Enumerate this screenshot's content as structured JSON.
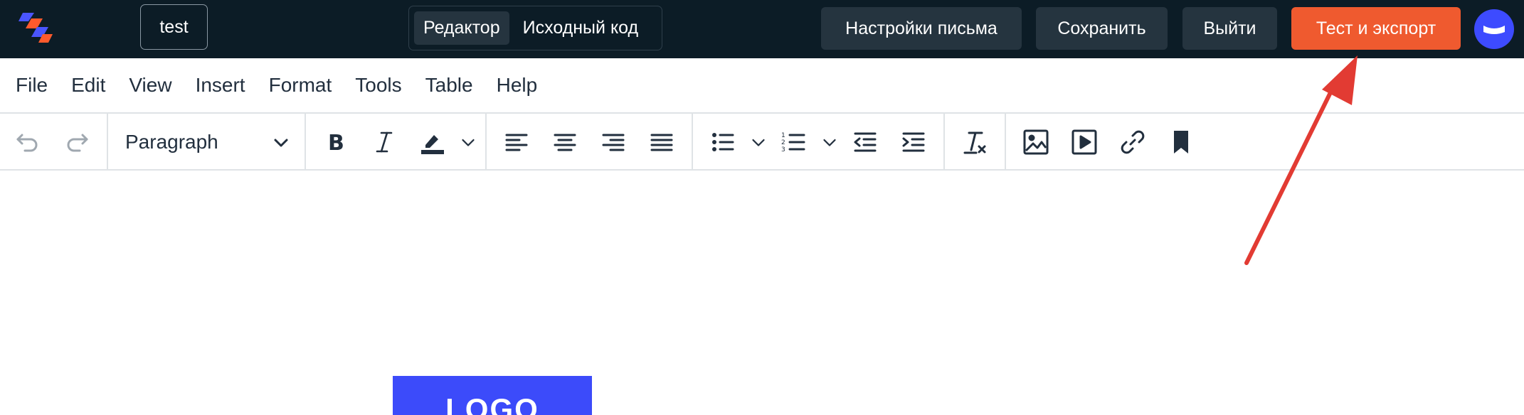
{
  "topbar": {
    "document_name": "test",
    "modes": [
      {
        "label": "Редактор",
        "active": true
      },
      {
        "label": "Исходный код",
        "active": false
      }
    ],
    "buttons": {
      "settings": "Настройки письма",
      "save": "Сохранить",
      "exit": "Выйти",
      "export": "Тест и экспорт"
    },
    "colors": {
      "background": "#0c1c26",
      "export": "#ef5a2f",
      "avatar": "#3d4bff"
    }
  },
  "menubar": {
    "items": [
      "File",
      "Edit",
      "View",
      "Insert",
      "Format",
      "Tools",
      "Table",
      "Help"
    ]
  },
  "toolbar": {
    "block_format": "Paragraph",
    "icons": [
      "undo-icon",
      "redo-icon",
      "bold-icon",
      "italic-icon",
      "highlight-icon",
      "align-left-icon",
      "align-center-icon",
      "align-right-icon",
      "justify-icon",
      "bullet-list-icon",
      "numbered-list-icon",
      "outdent-icon",
      "indent-icon",
      "clear-format-icon",
      "image-icon",
      "media-icon",
      "link-icon",
      "bookmark-icon"
    ]
  },
  "content": {
    "logo_text": "LOGO",
    "logo_color": "#3c4bfa"
  },
  "annotation": {
    "arrow_color": "#e23b33"
  }
}
